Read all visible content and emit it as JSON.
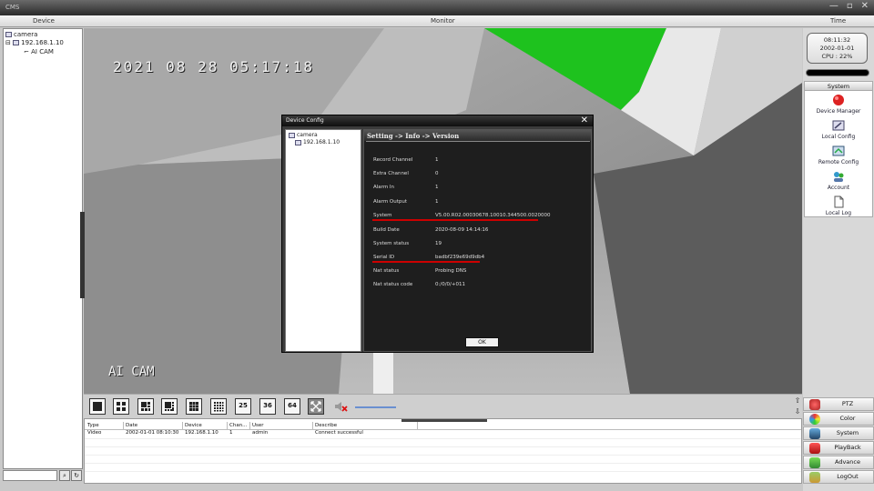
{
  "window": {
    "title": "CMS",
    "controls": [
      "—",
      "▫",
      "✕"
    ]
  },
  "header": {
    "device": "Device",
    "monitor": "Monitor",
    "time": "Time"
  },
  "device_tree": {
    "root": "camera",
    "ip": "192.168.1.10",
    "channel": "AI CAM"
  },
  "video": {
    "osd_time": "2021 08 28 05:17:18",
    "osd_name": "AI CAM"
  },
  "dialog": {
    "title": "Device Config",
    "close": "✕",
    "tree_root": "camera",
    "tree_ip": "192.168.1.10",
    "breadcrumb": "Setting -> Info -> Version",
    "fields": [
      {
        "label": "Record Channel",
        "value": "1"
      },
      {
        "label": "Extra Channel",
        "value": "0"
      },
      {
        "label": "Alarm In",
        "value": "1"
      },
      {
        "label": "Alarm Output",
        "value": "1"
      },
      {
        "label": "System",
        "value": "V5.00.R02.00030678.10010.344500.0020000"
      },
      {
        "label": "Build Date",
        "value": "2020-08-09 14:14:16"
      },
      {
        "label": "System status",
        "value": "19"
      },
      {
        "label": "Serial ID",
        "value": "badbf239e69d9db4"
      },
      {
        "label": "Nat status",
        "value": "Probing DNS"
      },
      {
        "label": "Nat status code",
        "value": "0:/0/0/+011"
      }
    ],
    "ok_label": "OK"
  },
  "clock": {
    "time": "08:11:32",
    "date": "2002-01-01",
    "cpu": "CPU : 22%"
  },
  "system_panel": {
    "header": "System",
    "items": [
      "Device Manager",
      "Local Config",
      "Remote Config",
      "Account",
      "Local Log"
    ]
  },
  "nav_buttons": [
    "PTZ",
    "Color",
    "System",
    "PlayBack",
    "Advance",
    "LogOut"
  ],
  "toolbar": {
    "layout_25": "25",
    "layout_36": "36",
    "layout_64": "64"
  },
  "log": {
    "columns": [
      "Type",
      "Date",
      "Device",
      "Chan...",
      "User",
      "Describe"
    ],
    "rows": [
      [
        "Video",
        "2002-01-01 08:10:30",
        "192.168.1.10",
        "1",
        "admin",
        "Connect successful"
      ]
    ]
  },
  "colors": {
    "video_green": "#1ec21e",
    "accent_red": "#cc0000",
    "dialog_bg": "#1e1e1e"
  }
}
